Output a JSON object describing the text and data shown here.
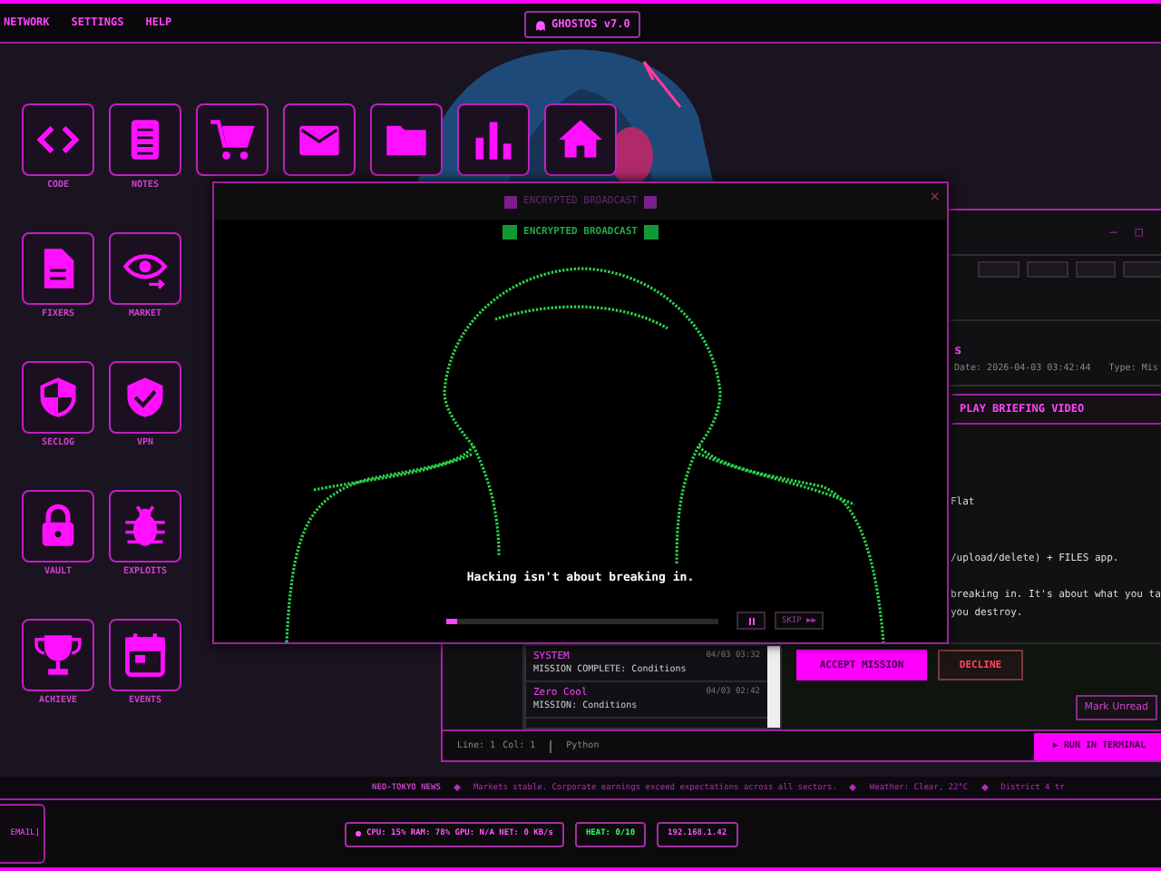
{
  "menu_bar": {
    "items": [
      "NETWORK",
      "SETTINGS",
      "HELP"
    ],
    "title": "GHOSTOS v7.0"
  },
  "desktop_icons": [
    [
      {
        "kind": "code",
        "label": "CODE"
      },
      {
        "kind": "notes",
        "label": "NOTES"
      },
      {
        "kind": "cart"
      },
      {
        "kind": "mail"
      },
      {
        "kind": "folder"
      },
      {
        "kind": "chart"
      },
      {
        "kind": "home"
      }
    ],
    [
      {
        "kind": "file",
        "label": "FIXERS"
      },
      {
        "kind": "eye",
        "label": "MARKET"
      }
    ],
    [
      {
        "kind": "shield-half",
        "label": "SECLOG"
      },
      {
        "kind": "shield-check",
        "label": "VPN"
      }
    ],
    [
      {
        "kind": "lock",
        "label": "VAULT"
      },
      {
        "kind": "bug",
        "label": "EXPLOITS"
      }
    ],
    [
      {
        "kind": "trophy",
        "label": "ACHIEVE"
      },
      {
        "kind": "calendar",
        "label": "EVENTS"
      }
    ]
  ],
  "mail_window": {
    "controls": [
      "–",
      "□"
    ],
    "subject": "s",
    "date": "Date: 2026-04-03 03:42:44",
    "type": "Type: Mis",
    "play_button": "PLAY BRIEFING VIDEO",
    "body": [
      "Flat",
      "/upload/delete) + FILES app.",
      "breaking in. It's about what you ta",
      "you destroy."
    ],
    "messages": [
      {
        "from": "SYSTEM",
        "time": "04/03 03:32",
        "subject": "MISSION COMPLETE: Conditions"
      },
      {
        "from": "Zero Cool",
        "time": "04/03 02:42",
        "subject": "MISSION: Conditions"
      }
    ],
    "accept": "ACCEPT MISSION",
    "decline": "DECLINE",
    "mark_unread": "Mark Unread"
  },
  "editor_status": {
    "line": "Line: 1",
    "col": "Col: 1",
    "language": "Python",
    "run_button": "▶ RUN IN TERMINAL"
  },
  "video_window": {
    "title": "ENCRYPTED BROADCAST",
    "close": "×",
    "badge": "ENCRYPTED BROADCAST",
    "caption": "Hacking isn't about breaking in.",
    "level": 0.04,
    "playing": true,
    "skip": "SKIP ▶▶"
  },
  "ticker": {
    "source": "NEO-TOKYO NEWS",
    "items": [
      "Markets stable. Corporate earnings exceed expectations across all sectors.",
      "Weather: Clear, 22°C",
      "District 4 tr"
    ]
  },
  "taskbar": {
    "app": "EMAIL]",
    "stats": "CPU: 15% RAM: 78% GPU: N/A NET: 0 KB/s",
    "heat": "HEAT: 0/10",
    "ip": "192.168.1.42"
  }
}
